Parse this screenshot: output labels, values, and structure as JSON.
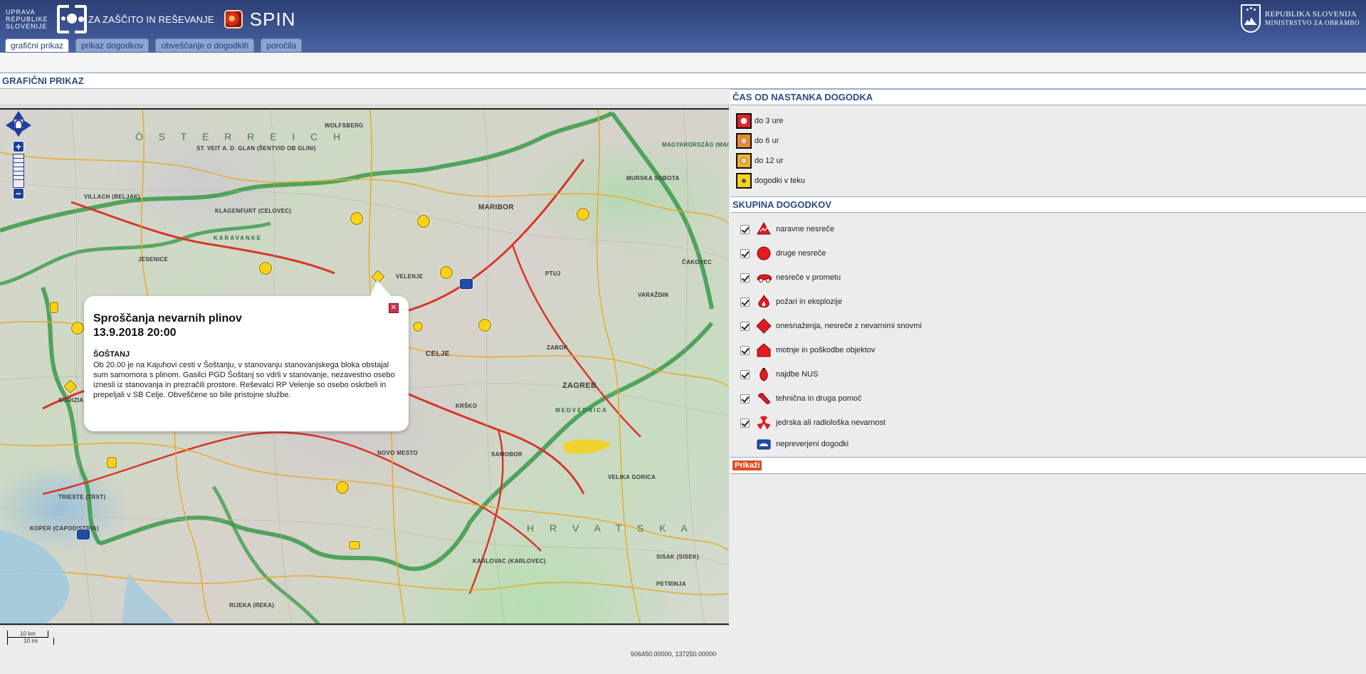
{
  "header": {
    "org_lines": [
      "UPRAVA",
      "REPUBLIKE",
      "SLOVENIJE"
    ],
    "agency": "ZA ZAŠČITO IN REŠEVANJE",
    "app_name": "SPIN",
    "ministry_line1": "REPUBLIKA SLOVENIJA",
    "ministry_line2": "MINISTRSTVO ZA OBRAMBO",
    "colors": {
      "header": "#3c5390",
      "accent": "#2d4a8a"
    }
  },
  "tabs": [
    {
      "label": "grafični prikaz",
      "active": true
    },
    {
      "label": "prikaz dogodkov",
      "active": false
    },
    {
      "label": "obveščanje o dogodkih",
      "active": false
    },
    {
      "label": "poročila",
      "active": false
    }
  ],
  "main": {
    "section_title": "GRAFIČNI PRIKAZ"
  },
  "map": {
    "labels": {
      "osterreich": "Ö S T E R R E I C H",
      "hrvatska": "H R V A T S K A",
      "magyarorszag": "MAGYARORSZÁG (MAGYARORSZÁG)",
      "klagenfurt": "KLAGENFURT (CELOVEC)",
      "maribor": "MARIBOR",
      "ptuj": "PTUJ",
      "celje": "CELJE",
      "velenje": "VELENJE",
      "jesenice": "JESENICE",
      "villach": "VILLACH (BELJAK)",
      "zagreb": "ZAGREB",
      "karlovac": "KARLOVAC (KARLOVEC)",
      "rijeka": "RIJEKA (REKA)",
      "trieste": "TRIESTE (TRST)",
      "koper": "KOPER (CAPODISTRIA)",
      "novo_mesto": "NOVO MESTO",
      "varazdin": "VARAŽDIN",
      "murska_sobota": "MURSKA SOBOTA",
      "samobor": "SAMOBOR",
      "wolfsberg": "WOLFSBERG",
      "st_veit": "ST. VEIT A. D. GLAN (ŠENTVID OB GLINI)",
      "sisak": "SISAK (SISEK)",
      "petrinja": "PETRINJA",
      "gorica": "GORIZIA (GORICA)",
      "cakovec": "ČAKOVEC",
      "krsko": "KRŠKO",
      "zabok": "ZABOK",
      "velika_gorica": "VELIKA GORICA",
      "medvednica": "MEDVEDNICA",
      "ljubelj": "KARAVANKE"
    },
    "scale_km": "10 km",
    "scale_mi": "10 mi",
    "coordinates": "506450.00000, 137250.00000"
  },
  "popup": {
    "title_line1": "Sproščanja nevarnih plinov",
    "title_line2": "13.9.2018 20:00",
    "place": "ŠOŠTANJ",
    "body": "Ob 20.00 je na Kajuhovi cesti v Šoštanju, v stanovanju stanovanjskega bloka obstajal sum samomora s plinom. Gasilci PGD Šoštanj so vdrli v stanovanje, nezavestno osebo iznesli iz stanovanja in prezračili prostore. Reševalci RP Velenje so osebo oskrbeli in prepeljali v SB Celje. Obveščene so bile pristojne službe.",
    "close_icon": "close-icon"
  },
  "legend_time": {
    "title": "ČAS OD NASTANKA DOGODKA",
    "items": [
      {
        "label": "do 3 ure",
        "color": "#e52323"
      },
      {
        "label": "do 6 ur",
        "color": "#f08a24"
      },
      {
        "label": "do 12 ur",
        "color": "#f5b321"
      },
      {
        "label": "dogodki v teku",
        "color": "#f7d21b"
      }
    ]
  },
  "legend_groups": {
    "title": "SKUPINA DOGODKOV",
    "items": [
      {
        "label": "naravne nesreče",
        "icon": "natural-disaster-icon",
        "checked": true
      },
      {
        "label": "druge nesreče",
        "icon": "other-accident-icon",
        "checked": true
      },
      {
        "label": "nesreče v prometu",
        "icon": "traffic-accident-icon",
        "checked": true
      },
      {
        "label": "požari in eksplozije",
        "icon": "fire-icon",
        "checked": true
      },
      {
        "label": "onesnaženja, nesreče z nevarnimi snovmi",
        "icon": "hazardous-substance-icon",
        "checked": true
      },
      {
        "label": "motnje in poškodbe objektov",
        "icon": "building-damage-icon",
        "checked": true
      },
      {
        "label": "najdbe NUS",
        "icon": "unexploded-ordnance-icon",
        "checked": true
      },
      {
        "label": "tehnična in druga pomoč",
        "icon": "technical-help-icon",
        "checked": true
      },
      {
        "label": "jedrska ali radiološka nevarnost",
        "icon": "radiation-icon",
        "checked": true
      },
      {
        "label": "nepreverjeni dogodki",
        "icon": "unverified-event-icon",
        "checked": false
      }
    ]
  },
  "actions": {
    "show_label": "Prikaži"
  }
}
